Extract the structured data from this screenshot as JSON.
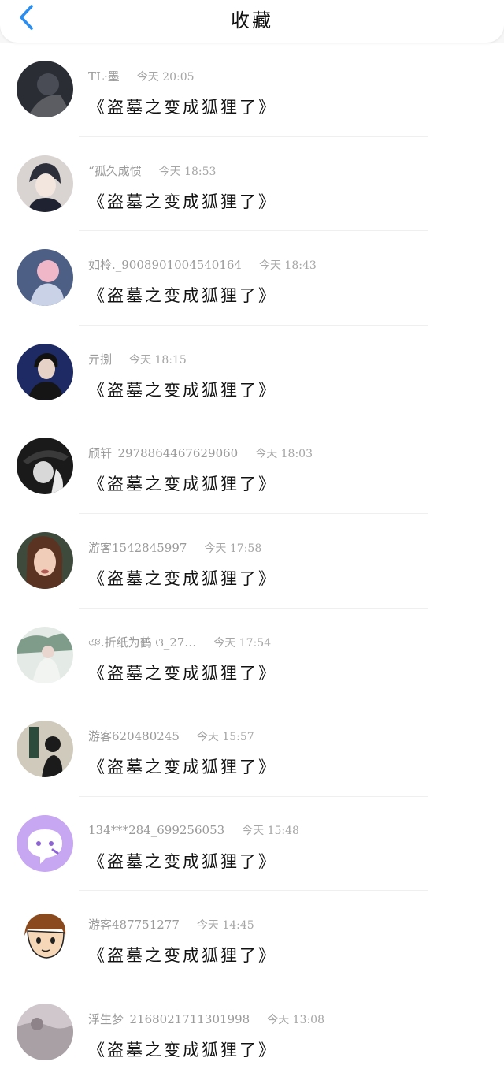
{
  "header": {
    "title": "收藏"
  },
  "items": [
    {
      "user": "TL·墨",
      "time": "今天 20:05",
      "book": "《盗墓之变成狐狸了》",
      "avatar_color": "#2b2d35"
    },
    {
      "user": "“孤久成惯",
      "time": "今天 18:53",
      "book": "《盗墓之变成狐狸了》",
      "avatar_color": "#cfc9c6"
    },
    {
      "user": "如柃._9008901004540164",
      "time": "今天 18:43",
      "book": "《盗墓之变成狐狸了》",
      "avatar_color": "#5b6b8f"
    },
    {
      "user": "亓捌",
      "time": "今天 18:15",
      "book": "《盗墓之变成狐狸了》",
      "avatar_color": "#22306a"
    },
    {
      "user": "颀轩_2978864467629060",
      "time": "今天 18:03",
      "book": "《盗墓之变成狐狸了》",
      "avatar_color": "#1c1c1c"
    },
    {
      "user": "游客1542845997",
      "time": "今天 17:58",
      "book": "《盗墓之变成狐狸了》",
      "avatar_color": "#6b4a3a"
    },
    {
      "user": "ঞ.折纸为鹤 ଓ_27…",
      "time": "今天 17:54",
      "book": "《盗墓之变成狐狸了》",
      "avatar_color": "#cdd6cf"
    },
    {
      "user": "游客620480245",
      "time": "今天 15:57",
      "book": "《盗墓之变成狐狸了》",
      "avatar_color": "#c8c4b8"
    },
    {
      "user": "134***284_699256053",
      "time": "今天 15:48",
      "book": "《盗墓之变成狐狸了》",
      "avatar_color": "#c7a6f2"
    },
    {
      "user": "游客487751277",
      "time": "今天 14:45",
      "book": "《盗墓之变成狐狸了》",
      "avatar_color": "#ffffff"
    },
    {
      "user": "浮生梦_2168021711301998",
      "time": "今天 13:08",
      "book": "《盗墓之变成狐狸了》",
      "avatar_color": "#c9c2c6"
    }
  ]
}
